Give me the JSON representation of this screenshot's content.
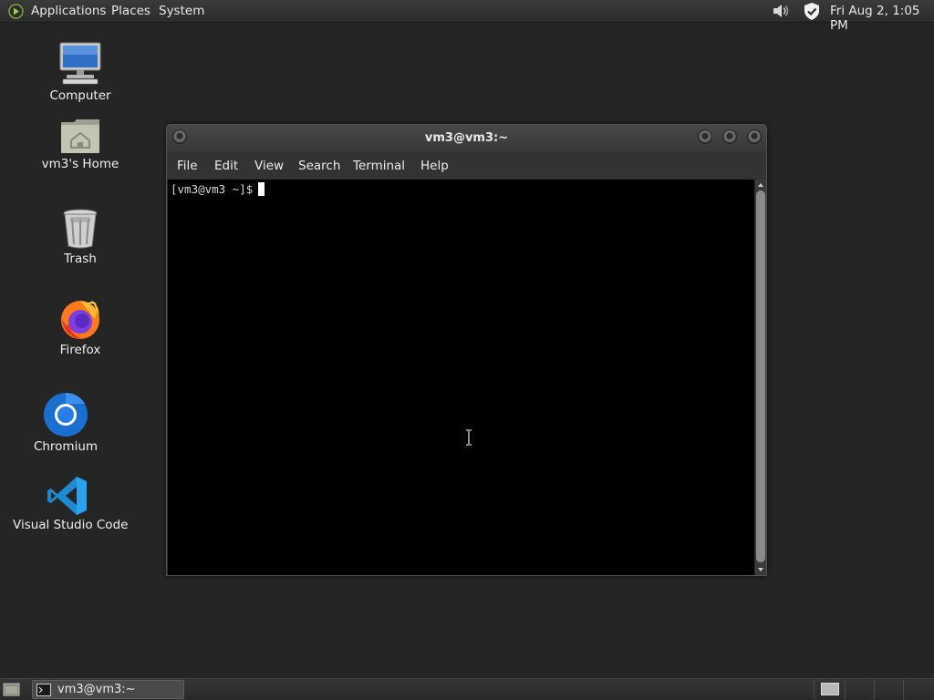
{
  "top_panel": {
    "applications_label": "Applications",
    "places_label": "Places",
    "system_label": "System",
    "clock": "Fri Aug  2,  1:05 PM"
  },
  "desktop": {
    "icons": [
      {
        "label": "Computer",
        "icon": "computer-icon"
      },
      {
        "label": "vm3's Home",
        "icon": "home-folder-icon"
      },
      {
        "label": "Trash",
        "icon": "trash-icon"
      },
      {
        "label": "Firefox",
        "icon": "firefox-icon"
      },
      {
        "label": "Chromium",
        "icon": "chromium-icon"
      },
      {
        "label": "Visual Studio Code",
        "icon": "vscode-icon"
      }
    ]
  },
  "terminal": {
    "title": "vm3@vm3:~",
    "menu": [
      "File",
      "Edit",
      "View",
      "Search",
      "Terminal",
      "Help"
    ],
    "prompt": "[vm3@vm3 ~]$"
  },
  "taskbar": {
    "task_label": "vm3@vm3:~"
  },
  "colors": {
    "desktop_bg": "#252525",
    "terminal_bg": "#000000",
    "panel_bg": "#2f2f2f"
  }
}
